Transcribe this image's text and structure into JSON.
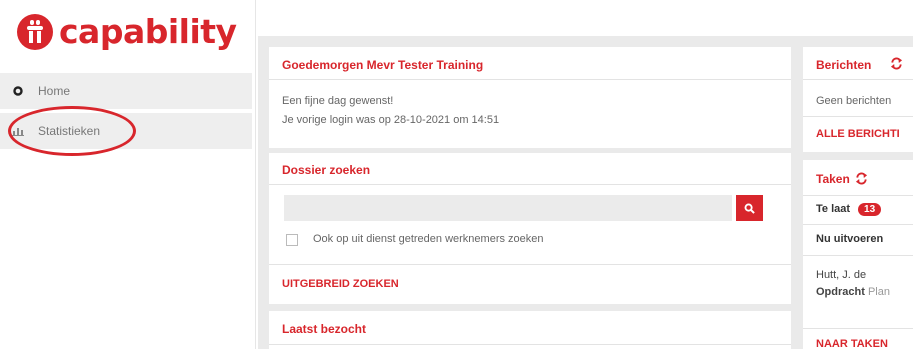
{
  "brand": {
    "name": "capability",
    "color": "#d8262c"
  },
  "sidebar": {
    "items": [
      {
        "label": "Home",
        "icon": "home-dot-icon"
      },
      {
        "label": "Statistieken",
        "icon": "bar-chart-icon"
      }
    ]
  },
  "welcome": {
    "title": "Goedemorgen Mevr Tester Training",
    "line1": "Een fijne dag gewenst!",
    "line2": "Je vorige login was op 28-10-2021 om 14:51"
  },
  "dossier": {
    "title": "Dossier zoeken",
    "search_value": "",
    "checkbox_label": "Ook op uit dienst getreden werknemers zoeken",
    "advanced_link": "UITGEBREID ZOEKEN"
  },
  "recent": {
    "title": "Laatst bezocht"
  },
  "berichten": {
    "title": "Berichten",
    "empty_text": "Geen berichten",
    "all_link": "ALLE BERICHTI"
  },
  "taken": {
    "title": "Taken",
    "late_label": "Te laat",
    "late_count": "13",
    "now_label": "Nu uitvoeren",
    "task_name": "Hutt, J. de",
    "task_field_label": "Opdracht",
    "task_field_value": "Plan",
    "tasks_link": "NAAR TAKEN"
  }
}
